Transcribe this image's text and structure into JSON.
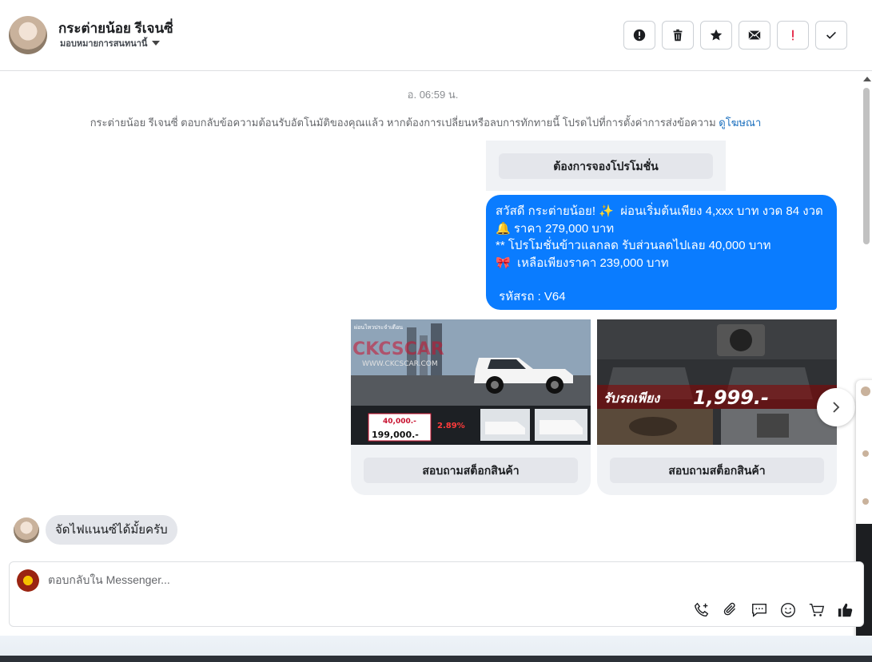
{
  "header": {
    "contact_name": "กระต่ายน้อย รีเจนซี่",
    "assign_label": "มอบหมายการสนทนานี้",
    "actions": [
      {
        "icon": "alert-circle-icon",
        "name": "mark-spam-button"
      },
      {
        "icon": "trash-icon",
        "name": "delete-button"
      },
      {
        "icon": "star-icon",
        "name": "star-button"
      },
      {
        "icon": "envelope-icon",
        "name": "mark-unread-button"
      },
      {
        "icon": "exclamation-icon",
        "name": "follow-up-button"
      },
      {
        "icon": "check-icon",
        "name": "mark-done-button"
      }
    ]
  },
  "chat": {
    "timestamp": "อ. 06:59 น.",
    "system_message": "กระต่ายน้อย รีเจนซี่ ตอบกลับข้อความต้อนรับอัตโนมัติของคุณแล้ว หากต้องการเปลี่ยนหรือลบการทักทายนี้ โปรดไปที่การตั้งค่าการส่งข้อความ",
    "system_link": "ดูโฆษณา",
    "quick_reply_label": "ต้องการจองโปรโมชั่น",
    "outgoing_lines": [
      "สวัสดี กระต่ายน้อย! ✨  ผ่อนเริ่มต้นเพียง 4,xxx บาท งวด 84 งวด",
      "🔔 ราคา 279,000 บาท",
      "** โปรโมชั่นข้าวแลกลด รับส่วนลดไปเลย 40,000 บาท",
      "🎀  เหลือเพียงราคา 239,000 บาท",
      "",
      " รหัสรถ : V64"
    ],
    "cards": [
      {
        "button_label": "สอบถามสต็อกสินค้า",
        "image": {
          "brand": "CKCSCAR",
          "website": "WWW.CKCSCAR.COM",
          "banner": "ผ่อนไหวประจำเดือน",
          "down_label": "40,000.-",
          "rate_label": "2.89%",
          "price_label": "199,000.-"
        }
      },
      {
        "button_label": "สอบถามสต็อกสินค้า",
        "image": {
          "promo": "รับรถเพียง",
          "amount": "1,999.-"
        }
      }
    ],
    "incoming_message": "จัดไฟแนนซ์ได้มั้ยครับ"
  },
  "composer": {
    "placeholder": "ตอบกลับใน Messenger...",
    "tools": [
      "call-add-icon",
      "paperclip-icon",
      "saved-reply-icon",
      "emoji-icon",
      "cart-icon",
      "thumbs-up-icon"
    ]
  },
  "colors": {
    "accent": "#0a7cff",
    "link": "#1a6fbe",
    "bubble_gray": "#e4e6eb",
    "panel_gray": "#f0f2f5"
  }
}
